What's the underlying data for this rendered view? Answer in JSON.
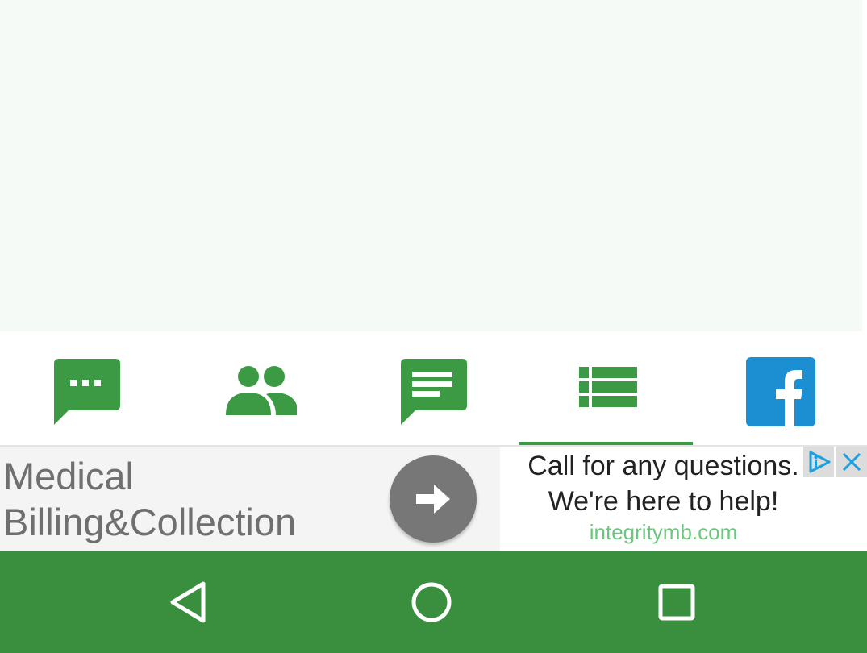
{
  "tabs": [
    {
      "icon": "chat-bubble-dots-icon",
      "selected": false
    },
    {
      "icon": "people-group-icon",
      "selected": false
    },
    {
      "icon": "message-text-icon",
      "selected": false
    },
    {
      "icon": "list-view-icon",
      "selected": true
    },
    {
      "icon": "facebook-icon",
      "selected": false
    }
  ],
  "colors": {
    "accent": "#3c9a45",
    "navbar": "#3a8f3e",
    "facebook": "#1b8fd1",
    "content_bg": "#f6faf6"
  },
  "ad": {
    "headline": "Medical\nBilling&Collection",
    "description": "Call for any questions.\nWe're here to help!",
    "url": "integritymb.com",
    "cta_icon": "arrow-right-icon",
    "choices_icon": "adchoices-icon",
    "close_icon": "close-icon"
  },
  "navbar": {
    "buttons": [
      "back-icon",
      "home-icon",
      "recents-icon"
    ]
  }
}
